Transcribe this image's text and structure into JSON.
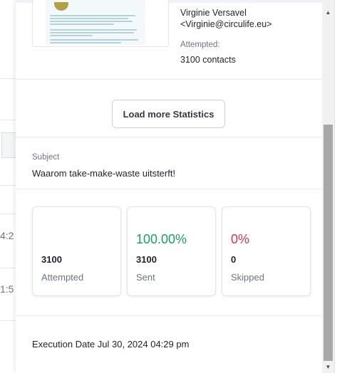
{
  "background": {
    "row_times": [
      "4:2",
      "1:5"
    ]
  },
  "email": {
    "sender_name": "Virginie Versavel",
    "sender_email": "<Virginie@circulife.eu>",
    "attempted_label": "Attempted:",
    "attempted_value": "3100 contacts"
  },
  "load_more_label": "Load more Statistics",
  "subject": {
    "label": "Subject",
    "value": "Waarom take-make-waste uitsterft!"
  },
  "stats": [
    {
      "percent": "",
      "number": "3100",
      "label": "Attempted"
    },
    {
      "percent": "100.00%",
      "number": "3100",
      "label": "Sent",
      "color": "#1e9e5a"
    },
    {
      "percent": "0%",
      "number": "0",
      "label": "Skipped",
      "color": "#dc3545"
    }
  ],
  "execution": "Execution Date Jul 30, 2024 04:29 pm",
  "scrollbar": {
    "up_icon": "triangle-up-icon",
    "down_icon": "triangle-down-icon"
  }
}
